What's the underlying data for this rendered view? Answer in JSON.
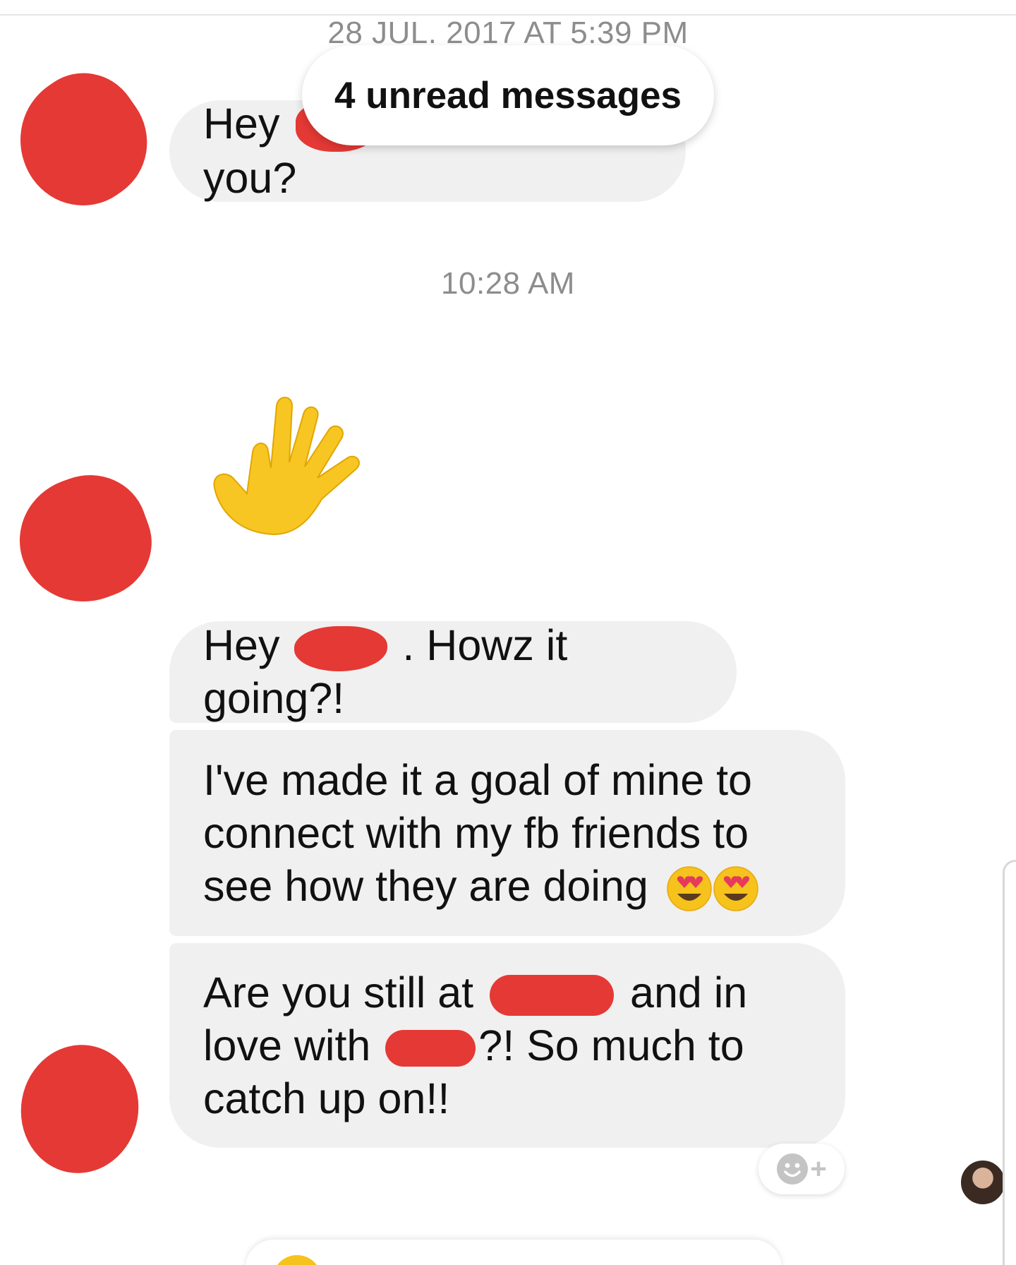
{
  "conversation": {
    "timestamps": {
      "first": "28 JUL. 2017 AT 5:39 PM",
      "second": "10:28 AM"
    },
    "unread_pill": "4 unread messages",
    "messages": [
      {
        "prefix": "Hey",
        "suffix": " how are you?"
      },
      {
        "type": "emoji",
        "emoji": "waving-hand-emoji"
      },
      {
        "prefix": "Hey",
        "suffix": ". Howz it going?!"
      },
      {
        "text": "I've made it a goal of mine to connect with my fb friends to see how they are doing",
        "emojis": [
          "heart-eyes-emoji",
          "heart-eyes-emoji"
        ]
      },
      {
        "part1": "Are you still at",
        "part2": " and in love with",
        "part3": "?! So much to catch up on!!"
      }
    ],
    "reaction_button": "+"
  },
  "colors": {
    "bubble": "#f0f0f0",
    "redaction": "#e53935",
    "timestamp": "#8d8d8d",
    "emoji_yellow": "#f6c21c"
  },
  "icons": {
    "reaction": "smiley-plus-icon",
    "seen": "avatar",
    "wave": "waving-hand-emoji"
  }
}
